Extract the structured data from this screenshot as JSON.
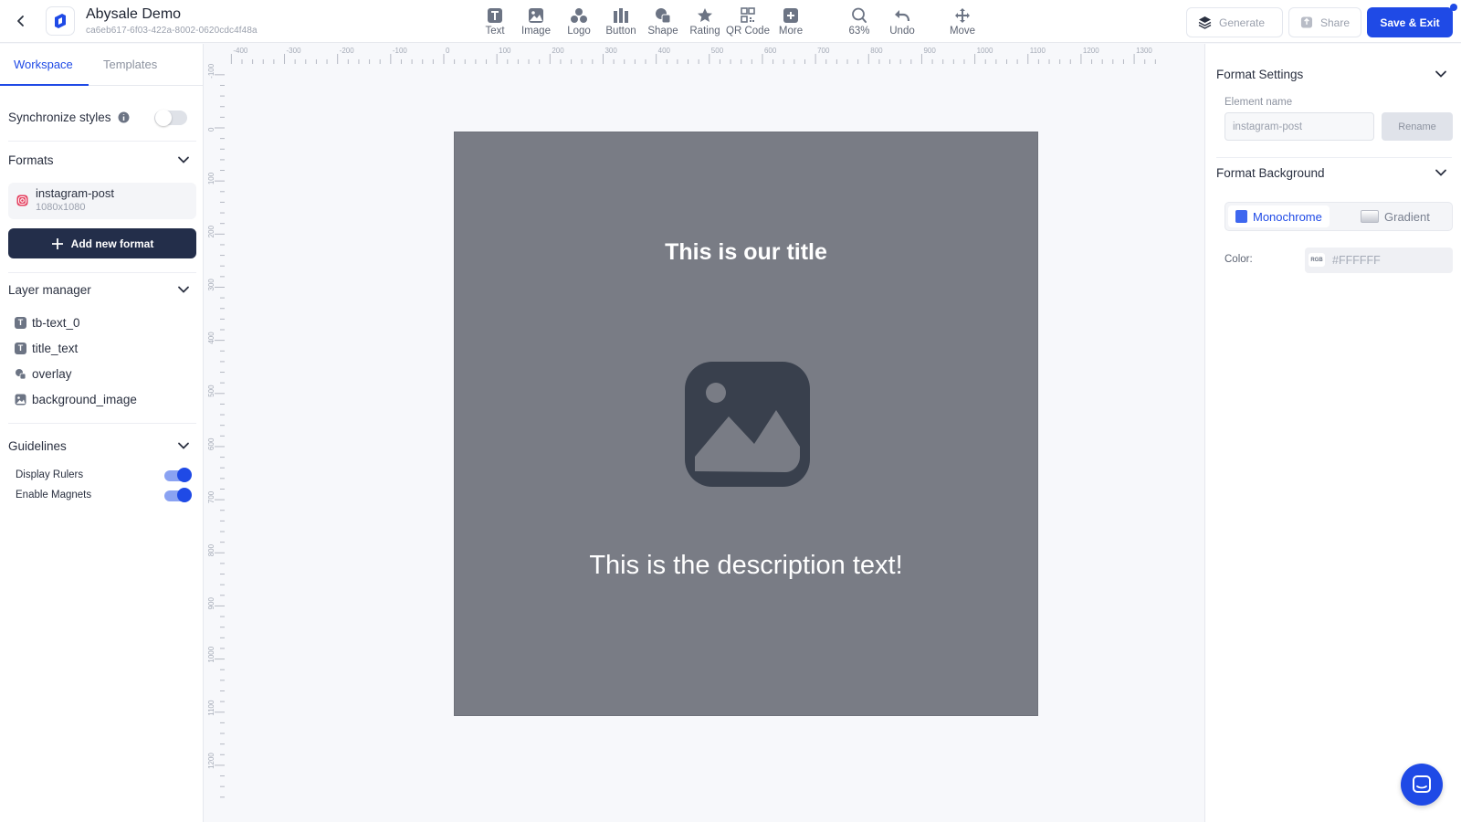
{
  "header": {
    "title": "Abysale Demo",
    "project_id": "ca6eb617-6f03-422a-8002-0620cdc4f48a"
  },
  "toolbar": {
    "tools": [
      {
        "label": "Text",
        "icon": "text-icon"
      },
      {
        "label": "Image",
        "icon": "image-icon"
      },
      {
        "label": "Logo",
        "icon": "logo-icon"
      },
      {
        "label": "Button",
        "icon": "button-icon"
      },
      {
        "label": "Shape",
        "icon": "shape-icon"
      },
      {
        "label": "Rating",
        "icon": "star-icon"
      },
      {
        "label": "QR Code",
        "icon": "qr-code-icon"
      },
      {
        "label": "More",
        "icon": "plus-square-icon"
      }
    ],
    "zoom_label": "63%",
    "undo_label": "Undo",
    "move_label": "Move",
    "generate_label": "Generate",
    "share_label": "Share",
    "save_label": "Save & Exit"
  },
  "left": {
    "tabs": [
      "Workspace",
      "Templates"
    ],
    "sync_label": "Synchronize styles",
    "sync_enabled": false,
    "formats_heading": "Formats",
    "format": {
      "name": "instagram-post",
      "size": "1080x1080"
    },
    "add_format_label": "Add new format",
    "layers_heading": "Layer manager",
    "layers": [
      {
        "name": "tb-text_0",
        "icon": "text-layer-icon"
      },
      {
        "name": "title_text",
        "icon": "text-layer-icon"
      },
      {
        "name": "overlay",
        "icon": "shape-layer-icon"
      },
      {
        "name": "background_image",
        "icon": "image-layer-icon"
      }
    ],
    "guidelines_heading": "Guidelines",
    "guidelines": [
      {
        "label": "Display Rulers",
        "enabled": true
      },
      {
        "label": "Enable Magnets",
        "enabled": true
      }
    ]
  },
  "rulers": {
    "horizontal": [
      "-400",
      "-300",
      "-200",
      "-100",
      "0",
      "100",
      "200",
      "300",
      "400",
      "500",
      "600",
      "700",
      "800",
      "900",
      "1000",
      "1100",
      "1200",
      "1300"
    ],
    "vertical": [
      "-100",
      "0",
      "100",
      "200",
      "300",
      "400",
      "500",
      "600",
      "700",
      "800",
      "900",
      "1000",
      "1100",
      "1200"
    ]
  },
  "canvas": {
    "title_text": "This is our title",
    "description_text": "This is the description text!",
    "background_color": "#797C85"
  },
  "right": {
    "format_settings_heading": "Format Settings",
    "element_name_label": "Element name",
    "element_name_value": "instagram-post",
    "rename_label": "Rename",
    "format_background_heading": "Format Background",
    "bg_modes": [
      "Monochrome",
      "Gradient"
    ],
    "active_bg_mode": "Monochrome",
    "color_label": "Color:",
    "color_mode": "RGB",
    "color_value": "#FFFFFF"
  },
  "colors": {
    "accent": "#1F4AE6",
    "dark_button": "#232E4A"
  }
}
